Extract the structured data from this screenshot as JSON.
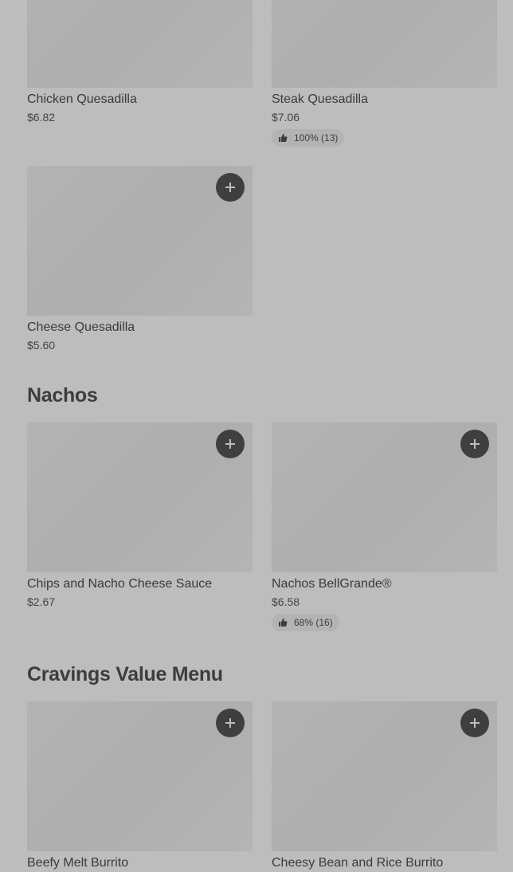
{
  "items": {
    "chicken_quesadilla": {
      "name": "Chicken Quesadilla",
      "price": "$6.82"
    },
    "steak_quesadilla": {
      "name": "Steak Quesadilla",
      "price": "$7.06",
      "rating": "100% (13)"
    },
    "cheese_quesadilla": {
      "name": "Cheese Quesadilla",
      "price": "$5.60"
    },
    "chips_nacho_cheese": {
      "name": "Chips and Nacho Cheese Sauce",
      "price": "$2.67"
    },
    "nachos_bellgrande": {
      "name": "Nachos BellGrande®",
      "price": "$6.58",
      "rating": "68% (16)"
    },
    "beefy_melt_burrito": {
      "name": "Beefy Melt Burrito"
    },
    "cheesy_bean_rice_burrito": {
      "name": "Cheesy Bean and Rice Burrito"
    }
  },
  "sections": {
    "nachos": "Nachos",
    "cravings": "Cravings Value Menu"
  },
  "icons": {
    "add": "plus-icon",
    "rating": "thumbs-up-icon"
  },
  "colors": {
    "overlay_bg": "#bdbdbd",
    "image_placeholder": "#b0b0b0",
    "add_button": "#3f3f3f",
    "text": "#3d3d3d"
  }
}
